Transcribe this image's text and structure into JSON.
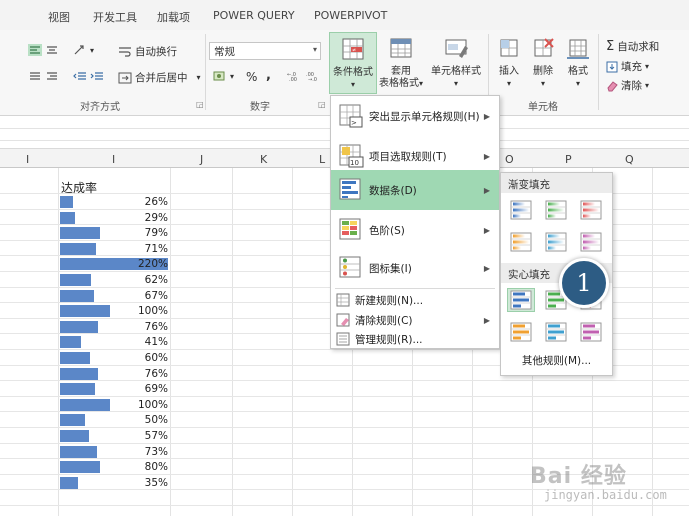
{
  "tabs": [
    "视图",
    "开发工具",
    "加载项",
    "POWER QUERY",
    "POWERPIVOT"
  ],
  "ribbon": {
    "wrap_text": "自动换行",
    "merge_center": "合并后居中",
    "number_format": "常规",
    "percent": "%",
    "comma": ",",
    "group_alignment": "对齐方式",
    "group_number": "数字",
    "group_cells": "单元格",
    "conditional_format": "条件格式",
    "table_format_1": "套用",
    "table_format_2": "表格格式",
    "cell_styles": "单元格样式",
    "insert": "插入",
    "delete": "删除",
    "format": "格式",
    "autosum": "自动求和",
    "fill": "填充",
    "clear": "清除"
  },
  "columns": [
    "I",
    "J",
    "K",
    "L",
    "O",
    "P",
    "Q"
  ],
  "sheet": {
    "header": "达成率",
    "rows": [
      {
        "label": "26%",
        "value": 26
      },
      {
        "label": "29%",
        "value": 29
      },
      {
        "label": "79%",
        "value": 79
      },
      {
        "label": "71%",
        "value": 71
      },
      {
        "label": "220%",
        "value": 220
      },
      {
        "label": "62%",
        "value": 62
      },
      {
        "label": "67%",
        "value": 67
      },
      {
        "label": "100%",
        "value": 100
      },
      {
        "label": "76%",
        "value": 76
      },
      {
        "label": "41%",
        "value": 41
      },
      {
        "label": "60%",
        "value": 60
      },
      {
        "label": "76%",
        "value": 76
      },
      {
        "label": "69%",
        "value": 69
      },
      {
        "label": "100%",
        "value": 100
      },
      {
        "label": "50%",
        "value": 50
      },
      {
        "label": "57%",
        "value": 57
      },
      {
        "label": "73%",
        "value": 73
      },
      {
        "label": "80%",
        "value": 80
      },
      {
        "label": "35%",
        "value": 35
      }
    ]
  },
  "menu": {
    "items": [
      {
        "label": "突出显示单元格规则(H)"
      },
      {
        "label": "项目选取规则(T)"
      },
      {
        "label": "数据条(D)"
      },
      {
        "label": "色阶(S)"
      },
      {
        "label": "图标集(I)"
      }
    ],
    "small_items": [
      {
        "label": "新建规则(N)..."
      },
      {
        "label": "清除规则(C)"
      },
      {
        "label": "管理规则(R)..."
      }
    ]
  },
  "submenu": {
    "gradient_fill": "渐变填充",
    "solid_fill": "实心填充",
    "more_rules": "其他规则(M)..."
  },
  "callout": "1",
  "watermark": {
    "main": "Bai 经验",
    "sub": "jingyan.baidu.com"
  },
  "colors": {
    "databar": "#5b87c8",
    "menu_active": "#9fd8b3",
    "callout": "#2d5c84"
  }
}
